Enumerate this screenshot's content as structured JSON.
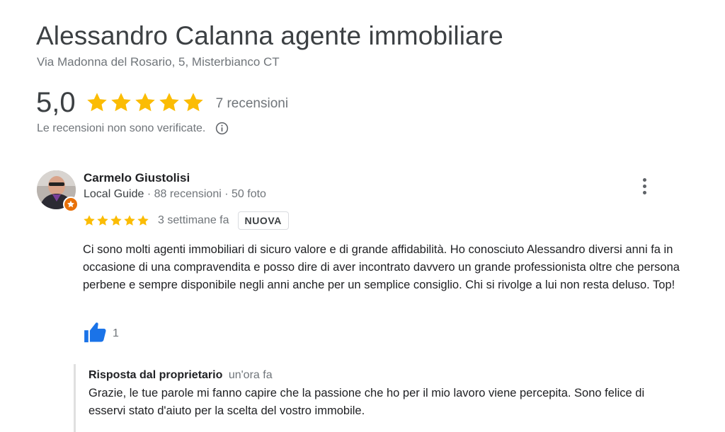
{
  "business": {
    "name": "Alessandro Calanna agente immobiliare",
    "address": "Via Madonna del Rosario, 5, Misterbianco CT"
  },
  "summary": {
    "rating": "5,0",
    "stars": 5,
    "review_count_label": "7 recensioni",
    "unverified_note": "Le recensioni non sono verificate."
  },
  "review": {
    "author": "Carmelo Giustolisi",
    "author_badge": "Local Guide",
    "author_meta": " · 88 recensioni · 50 foto",
    "stars": 5,
    "time": "3 settimane fa",
    "badge": "NUOVA",
    "text": "Ci sono molti agenti immobiliari di sicuro valore e di grande affidabilità. Ho conosciuto Alessandro diversi anni fa in occasione di una compravendita e posso dire di aver incontrato davvero un grande professionista oltre che persona perbene e sempre disponibile negli anni anche per un semplice consiglio. Chi si rivolge a lui non resta deluso. Top!",
    "likes": "1"
  },
  "owner_reply": {
    "label": "Risposta dal proprietario",
    "time": "un'ora fa",
    "text": "Grazie, le tue parole mi fanno capire che la passione che ho per il mio lavoro viene percepita. Sono felice di esservi stato d'aiuto per la scelta del vostro immobile."
  },
  "colors": {
    "star": "#fbbc04",
    "like": "#1a73e8",
    "guide_badge": "#e8710a"
  },
  "icons": [
    "star-icon",
    "info-icon",
    "more-vert-icon",
    "thumb-up-icon",
    "local-guide-badge-icon"
  ]
}
